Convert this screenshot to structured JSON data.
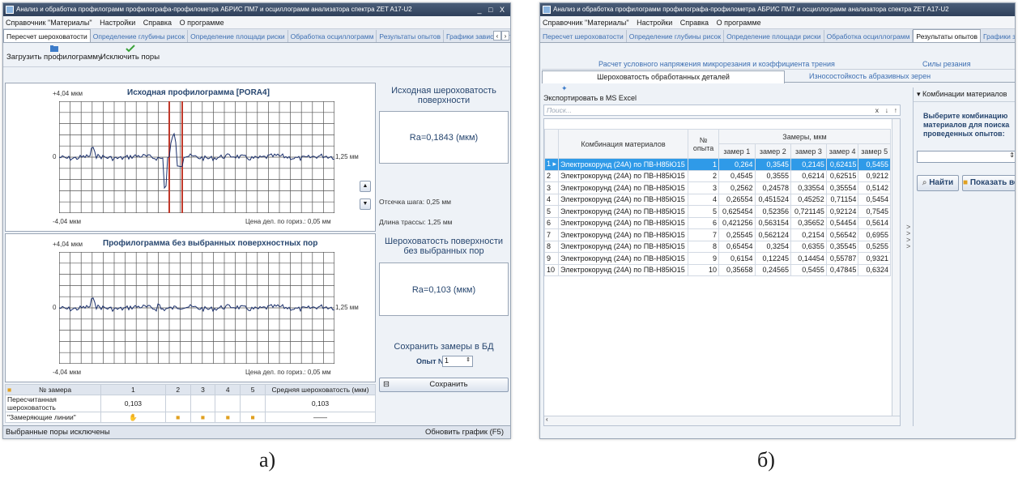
{
  "win_a": {
    "title": "Анализ и обработка профилограмм профилографа-профилометра АБРИС ПМ7 и осциллограмм анализатора спектра ZET A17-U2",
    "window_controls": "_ □ X",
    "menu": [
      "Справочник \"Материалы\"",
      "Настройки",
      "Справка",
      "О программе"
    ],
    "tabs": [
      "Пересчет шероховатости",
      "Определение глубины рисок",
      "Определение площади риски",
      "Обработка осциллограмм",
      "Результаты опытов",
      "Графики зависимости параме"
    ],
    "active_tab": 0,
    "toolbar": {
      "load": "Загрузить профилограмму",
      "exclude": "Исключить поры"
    },
    "chart1": {
      "y_top": "+4,04 мкм",
      "title": "Исходная профилограмма [PORA4]",
      "y_zero": "0",
      "x_right": "1,25 мм",
      "y_bottom": "-4,04 мкм",
      "scale": "Цена дел. по гориз.: 0,05 мм"
    },
    "chart2": {
      "y_top": "+4,04 мкм",
      "title": "Профилограмма без выбранных поверхностных пор",
      "y_zero": "0",
      "x_right": "1,25 мм",
      "y_bottom": "-4,04 мкм",
      "scale": "Цена дел. по гориз.: 0,05 мм"
    },
    "side1": {
      "heading": "Исходная шероховатость поверхности",
      "ra": "Ra=0,1843 (мкм)",
      "cutoff": "Отсечка шага: 0,25 мм",
      "length": "Длина трассы: 1,25 мм"
    },
    "side2": {
      "heading": "Шероховатость поверхности без выбранных пор",
      "ra": "Ra=0,103 (мкм)"
    },
    "save_box": {
      "heading": "Сохранить замеры в БД",
      "label": "Опыт №",
      "value": "1",
      "save": "Сохранить"
    },
    "table": {
      "headers": [
        "№ замера",
        "1",
        "2",
        "3",
        "4",
        "5",
        "Средняя шероховатость (мкм)"
      ],
      "row1_label": "Пересчитанная шероховатость",
      "row1_v1": "0,103",
      "row1_avg": "0,103",
      "row2_label": "\"Замеряющие линии\"",
      "row2_avg": "——"
    },
    "status": "Выбранные поры исключены",
    "refresh": "Обновить график (F5)"
  },
  "win_b": {
    "title": "Анализ и обработка профилограмм профилографа-профилометра АБРИС ПМ7 и осциллограмм анализатора спектра ZET A17-U2",
    "menu": [
      "Справочник \"Материалы\"",
      "Настройки",
      "Справка",
      "О программе"
    ],
    "tabs": [
      "Пересчет шероховатости",
      "Определение глубины рисок",
      "Определение площади риски",
      "Обработка осциллограмм",
      "Результаты опытов",
      "Графики зависимости параме"
    ],
    "active_tab": 4,
    "subtabs_row1": [
      "Расчет условного напряжения микрорезания и коэффициента трения",
      "Силы резания"
    ],
    "subtabs_row2": [
      "Шероховатость обработанных деталей",
      "Износостойкость абразивных зерен"
    ],
    "export": "Экспортировать в MS Excel",
    "search_placeholder": "Поиск...",
    "search_buttons": [
      "x",
      "↓",
      "↑"
    ],
    "col_material": "Комбинация материалов",
    "col_num": "№ опыта",
    "col_group": "Замеры, мкм",
    "cols": [
      "замер 1",
      "замер 2",
      "замер 3",
      "замер 4",
      "замер 5"
    ],
    "rows": [
      {
        "i": "1",
        "mat": "Электрокорунд (24А) по ПВ-Н85Ю15",
        "n": "1",
        "v": [
          "0,264",
          "0,3545",
          "0,2145",
          "0,62415",
          "0,5455"
        ]
      },
      {
        "i": "2",
        "mat": "Электрокорунд (24А) по ПВ-Н85Ю15",
        "n": "2",
        "v": [
          "0,4545",
          "0,3555",
          "0,6214",
          "0,62515",
          "0,9212"
        ]
      },
      {
        "i": "3",
        "mat": "Электрокорунд (24А) по ПВ-Н85Ю15",
        "n": "3",
        "v": [
          "0,2562",
          "0,24578",
          "0,33554",
          "0,35554",
          "0,5142"
        ]
      },
      {
        "i": "4",
        "mat": "Электрокорунд (24А) по ПВ-Н85Ю15",
        "n": "4",
        "v": [
          "0,26554",
          "0,451524",
          "0,45252",
          "0,71154",
          "0,5454"
        ]
      },
      {
        "i": "5",
        "mat": "Электрокорунд (24А) по ПВ-Н85Ю15",
        "n": "5",
        "v": [
          "0,625454",
          "0,52356",
          "0,721145",
          "0,92124",
          "0,7545"
        ]
      },
      {
        "i": "6",
        "mat": "Электрокорунд (24А) по ПВ-Н85Ю15",
        "n": "6",
        "v": [
          "0,421256",
          "0,563154",
          "0,35652",
          "0,54454",
          "0,5614"
        ]
      },
      {
        "i": "7",
        "mat": "Электрокорунд (24А) по ПВ-Н85Ю15",
        "n": "7",
        "v": [
          "0,25545",
          "0,562124",
          "0,2154",
          "0,56542",
          "0,6955"
        ]
      },
      {
        "i": "8",
        "mat": "Электрокорунд (24А) по ПВ-Н85Ю15",
        "n": "8",
        "v": [
          "0,65454",
          "0,3254",
          "0,6355",
          "0,35545",
          "0,5255"
        ]
      },
      {
        "i": "9",
        "mat": "Электрокорунд (24А) по ПВ-Н85Ю15",
        "n": "9",
        "v": [
          "0,6154",
          "0,12245",
          "0,14454",
          "0,55787",
          "0,9321"
        ]
      },
      {
        "i": "10",
        "mat": "Электрокорунд (24А) по ПВ-Н85Ю15",
        "n": "10",
        "v": [
          "0,35658",
          "0,24565",
          "0,5455",
          "0,47845",
          "0,6324"
        ]
      }
    ],
    "right_panel": {
      "header": "Комбинации материалов",
      "hint": "Выберите комбинацию материалов для поиска проведенных опытов:",
      "find": "Найти",
      "show_all": "Показать все"
    }
  },
  "captions": {
    "a": "а)",
    "b": "б)"
  },
  "colors": {
    "accent": "#2f9ae8",
    "title_bar": "#3a4c68",
    "marker": "#c0392b"
  }
}
